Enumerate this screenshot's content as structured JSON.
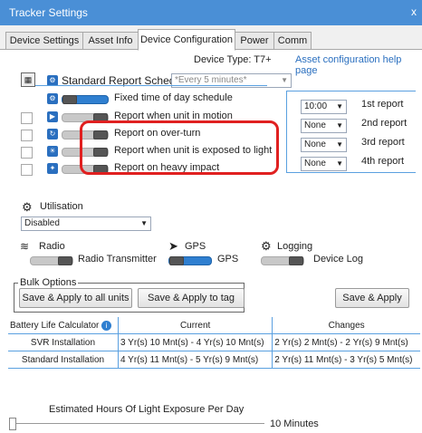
{
  "window": {
    "title": "Tracker Settings",
    "close": "x"
  },
  "tabs": [
    "Device Settings",
    "Asset Info",
    "Device Configuration",
    "Power",
    "Comm"
  ],
  "device_type": "Device Type: T7+",
  "help_link": "Asset configuration help page",
  "schedule": {
    "label": "Standard Report Schedule",
    "value": "*Every 5 minutes*"
  },
  "options": [
    "Fixed time of day schedule",
    "Report when unit in motion",
    "Report on over-turn",
    "Report when unit is exposed to light",
    "Report on heavy impact"
  ],
  "reports": [
    {
      "value": "10:00",
      "label": "1st report"
    },
    {
      "value": "None",
      "label": "2nd report"
    },
    {
      "value": "None",
      "label": "3rd report"
    },
    {
      "value": "None",
      "label": "4th report"
    }
  ],
  "utilisation": {
    "label": "Utilisation",
    "value": "Disabled"
  },
  "radio": {
    "title": "Radio",
    "toggle_label": "Radio Transmitter"
  },
  "gps": {
    "title": "GPS",
    "toggle_label": "GPS"
  },
  "logging": {
    "title": "Logging",
    "toggle_label": "Device Log"
  },
  "bulk": {
    "legend": "Bulk Options",
    "apply_all": "Save & Apply to all units",
    "apply_tag": "Save & Apply to tag",
    "save_apply": "Save & Apply"
  },
  "battery": {
    "header": "Battery Life Calculator",
    "current": "Current",
    "changes": "Changes",
    "rows": [
      {
        "name": "SVR Installation",
        "current": "3 Yr(s) 10 Mnt(s) - 4 Yr(s) 10 Mnt(s)",
        "changes": "2 Yr(s) 2 Mnt(s) - 2 Yr(s) 9 Mnt(s)"
      },
      {
        "name": "Standard Installation",
        "current": "4 Yr(s) 11 Mnt(s) - 5 Yr(s) 9 Mnt(s)",
        "changes": "2 Yr(s) 11 Mnt(s) - 3 Yr(s) 5 Mnt(s)"
      }
    ]
  },
  "light": {
    "label": "Estimated Hours Of Light Exposure Per Day",
    "value": "10 Minutes"
  },
  "colors": {
    "accent": "#2f7fd0",
    "highlight": "#e02020",
    "titlebar": "#4a8fd6"
  }
}
